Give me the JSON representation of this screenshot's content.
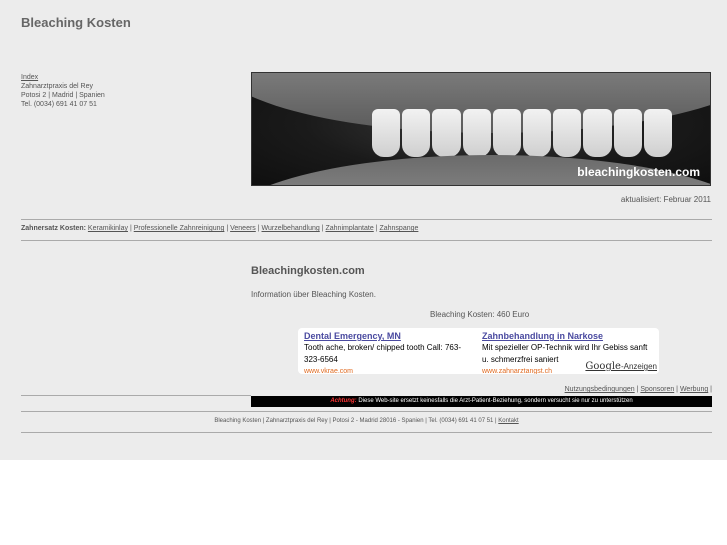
{
  "site": {
    "title": "Bleaching Kosten"
  },
  "contact": {
    "index_link": "Index",
    "practice": "Zahnarztpraxis del Rey",
    "address": "Potosi 2 | Madrid | Spanien",
    "phone": "Tel. (0034) 691 41 07 51"
  },
  "hero": {
    "watermark": "bleachingkosten.com"
  },
  "updated": "aktualisiert: Februar 2011",
  "nav": {
    "label": "Zahnersatz Kosten:",
    "items": [
      "Keramikinlay",
      "Professionelle Zahnreinigung",
      "Veneers",
      "Wurzelbehandlung",
      "Zahnimplantate",
      "Zahnspange"
    ]
  },
  "content": {
    "heading": "Bleachingkosten.com",
    "intro": "Information über Bleaching Kosten.",
    "price": "Bleaching Kosten: 460 Euro"
  },
  "ads": [
    {
      "title": "Dental Emergency, MN",
      "text": "Tooth ache, broken/ chipped tooth Call: 763-323-6564",
      "url": "www.vkrae.com"
    },
    {
      "title": "Zahnbehandlung in Narkose",
      "text": "Mit spezieller OP-Technik wird Ihr Gebiss sanft u. schmerzfrei saniert",
      "url": "www.zahnarztangst.ch"
    }
  ],
  "google_label": {
    "brand": "Google",
    "suffix": "-Anzeigen"
  },
  "footer_links": [
    "Nutzungsbedingungen",
    "Sponsoren",
    "Werbung"
  ],
  "warning": {
    "label": "Achtung:",
    "text": "Diese Web-site ersetzt keinesfalls die Arzt-Patient-Beziehung, sondern versucht sie nur zu unterstützen"
  },
  "bottom": {
    "text": "Bleaching Kosten | Zahnarztpraxis del Rey | Potosi 2 - Madrid 28016 - Spanien | Tel. (0034) 691 41 07 51 |",
    "contact_link": "Kontakt"
  }
}
